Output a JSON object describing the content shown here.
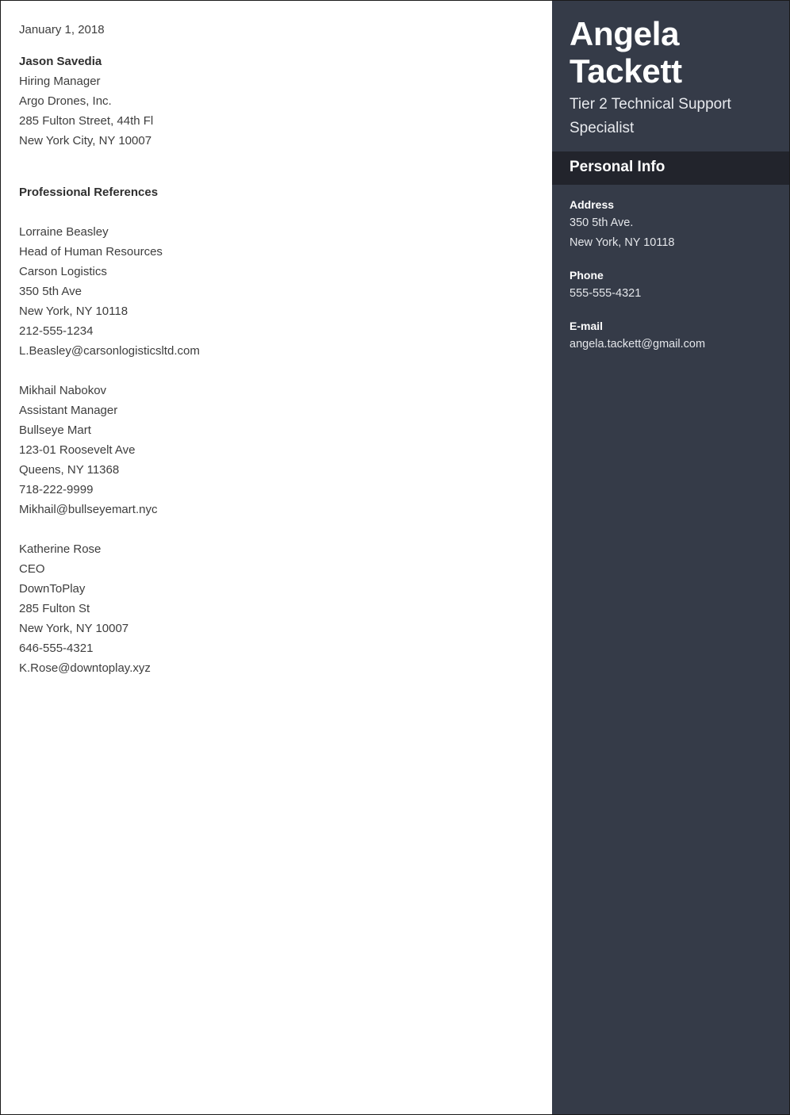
{
  "document": {
    "date": "January 1, 2018"
  },
  "recipient": {
    "name": "Jason Savedia",
    "job_title": "Hiring Manager",
    "company": "Argo Drones, Inc.",
    "street": "285 Fulton Street, 44th Fl",
    "city_state_zip": "New York City, NY 10007"
  },
  "references_section": {
    "heading": "Professional References",
    "references": [
      {
        "name": "Lorraine Beasley",
        "job_title": "Head of Human Resources",
        "company": "Carson Logistics",
        "street": "350 5th Ave",
        "city_state_zip": "New York, NY 10118",
        "phone": "212-555-1234",
        "email": "L.Beasley@carsonlogisticsltd.com"
      },
      {
        "name": "Mikhail Nabokov",
        "job_title": "Assistant Manager",
        "company": "Bullseye Mart",
        "street": "123-01 Roosevelt Ave",
        "city_state_zip": "Queens, NY 11368",
        "phone": "718-222-9999",
        "email": "Mikhail@bullseyemart.nyc"
      },
      {
        "name": "Katherine Rose",
        "job_title": "CEO",
        "company": "DownToPlay",
        "street": "285 Fulton St",
        "city_state_zip": "New York, NY 10007",
        "phone": "646-555-4321",
        "email": "K.Rose@downtoplay.xyz"
      }
    ]
  },
  "sidebar": {
    "candidate_name_line1": "Angela",
    "candidate_name_line2": "Tackett",
    "candidate_title": "Tier 2 Technical Support Specialist",
    "section_heading": "Personal Info",
    "info": [
      {
        "label": "Address",
        "value_line1": "350 5th Ave.",
        "value_line2": "New York, NY 10118"
      },
      {
        "label": "Phone",
        "value_line1": "555-555-4321"
      },
      {
        "label": "E-mail",
        "value_line1": "angela.tackett@gmail.com"
      }
    ],
    "colors": {
      "background": "#353b48",
      "band_background": "#22242c",
      "text": "#ffffff"
    }
  }
}
